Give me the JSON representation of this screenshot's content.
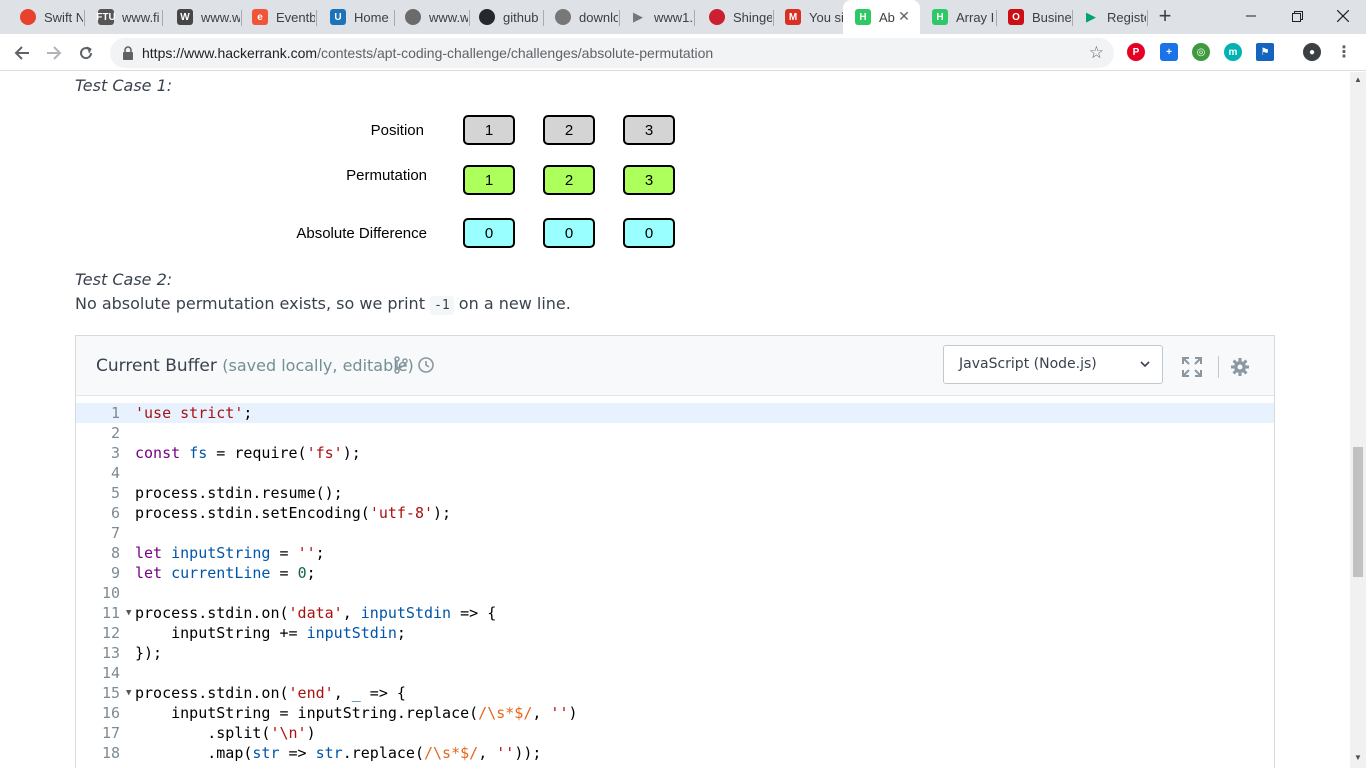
{
  "browser": {
    "tabs": [
      {
        "label": "Swift N",
        "icon": "swift-icon",
        "color": "#e8412c",
        "glyph": ""
      },
      {
        "label": "www.fi",
        "icon": "ftu-icon",
        "color": "#555555",
        "glyph": "FTU"
      },
      {
        "label": "www.w",
        "icon": "wordpress-icon",
        "color": "#464646",
        "glyph": "W"
      },
      {
        "label": "Eventb",
        "icon": "eventbrite-icon",
        "color": "#f05537",
        "glyph": "e"
      },
      {
        "label": "Home",
        "icon": "udemy-icon",
        "color": "#1d72b8",
        "glyph": "U"
      },
      {
        "label": "www.w",
        "icon": "image-icon",
        "color": "#6b6b6b",
        "glyph": ""
      },
      {
        "label": "github",
        "icon": "github-icon",
        "color": "#24292e",
        "glyph": ""
      },
      {
        "label": "downlo",
        "icon": "download-icon",
        "color": "#777777",
        "glyph": ""
      },
      {
        "label": "www1.",
        "icon": "play-icon",
        "color": "#777777",
        "glyph": ""
      },
      {
        "label": "Shinge",
        "icon": "shingeki-icon",
        "color": "#cc1f2f",
        "glyph": ""
      },
      {
        "label": "You sig",
        "icon": "gmail-icon",
        "color": "#d93025",
        "glyph": "M"
      },
      {
        "label": "Ab",
        "icon": "hackerrank-icon",
        "color": "#2ec866",
        "glyph": "H",
        "active": true
      },
      {
        "label": "Array I",
        "icon": "hackerrank-icon",
        "color": "#2ec866",
        "glyph": "H"
      },
      {
        "label": "Busine",
        "icon": "opera-icon",
        "color": "#cc0f16",
        "glyph": "O"
      },
      {
        "label": "Registe",
        "icon": "google-play-icon",
        "color": "#00a173",
        "glyph": ""
      }
    ],
    "url_host": "https://www.hackerrank.com",
    "url_path": "/contests/apt-coding-challenge/challenges/absolute-permutation"
  },
  "content": {
    "test_case_1": "Test Case 1:",
    "rows": [
      {
        "label": "Position",
        "values": [
          "1",
          "2",
          "3"
        ]
      },
      {
        "label": "Permutation",
        "values": [
          "1",
          "2",
          "3"
        ]
      },
      {
        "label": "Absolute Difference",
        "values": [
          "0",
          "0",
          "0"
        ]
      }
    ],
    "test_case_2": "Test Case 2:",
    "tc2_text_before": "No absolute permutation exists, so we print ",
    "tc2_code": "-1",
    "tc2_text_after": " on a new line."
  },
  "editor": {
    "title": "Current Buffer",
    "subtitle": "(saved locally, editable)",
    "language": "JavaScript (Node.js)",
    "lines": [
      "1",
      "2",
      "3",
      "4",
      "5",
      "6",
      "7",
      "8",
      "9",
      "10",
      "11",
      "12",
      "13",
      "14",
      "15",
      "16",
      "17",
      "18"
    ]
  }
}
